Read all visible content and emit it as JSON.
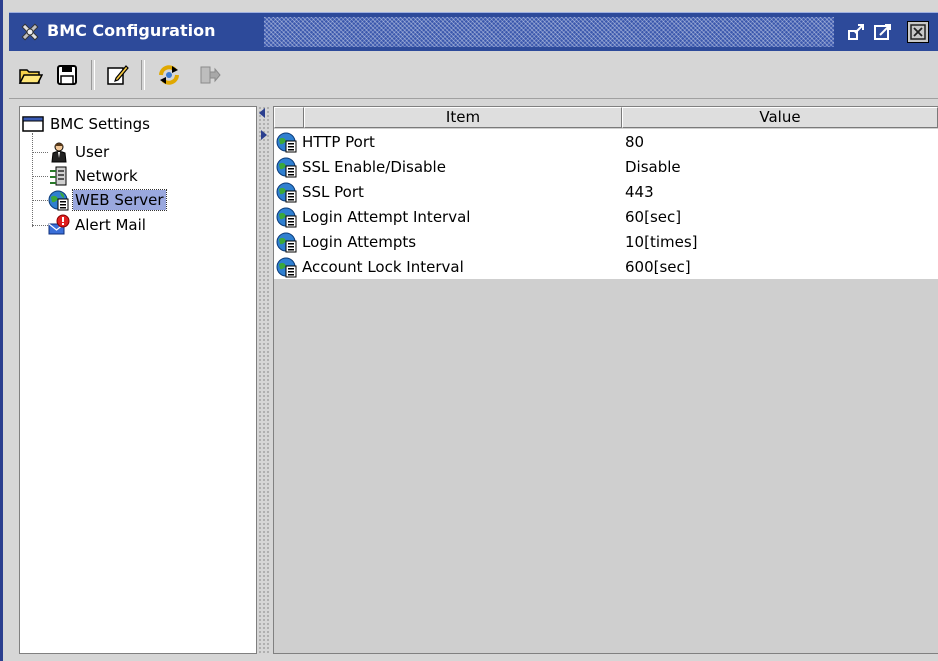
{
  "window": {
    "title": "BMC Configuration",
    "colors": {
      "title_bar": "#2d4a9a",
      "selection": "#9aa8de",
      "panel": "#d6d6d6"
    }
  },
  "toolbar": {
    "buttons": [
      {
        "icon": "folder-open-icon"
      },
      {
        "icon": "save-icon"
      },
      {
        "icon": "edit-icon"
      },
      {
        "icon": "refresh-icon"
      },
      {
        "icon": "exit-icon"
      }
    ]
  },
  "tree": {
    "root_label": "BMC Settings",
    "items": [
      {
        "label": "User",
        "icon": "user-icon",
        "selected": false
      },
      {
        "label": "Network",
        "icon": "network-icon",
        "selected": false
      },
      {
        "label": "WEB Server",
        "icon": "web-server-icon",
        "selected": true
      },
      {
        "label": "Alert Mail",
        "icon": "alert-mail-icon",
        "selected": false
      }
    ]
  },
  "table": {
    "columns": [
      "Item",
      "Value"
    ],
    "rows": [
      {
        "item": "HTTP Port",
        "value": "80"
      },
      {
        "item": "SSL Enable/Disable",
        "value": "Disable"
      },
      {
        "item": "SSL Port",
        "value": "443"
      },
      {
        "item": "Login Attempt Interval",
        "value": "60[sec]"
      },
      {
        "item": "Login Attempts",
        "value": "10[times]"
      },
      {
        "item": "Account Lock Interval",
        "value": "600[sec]"
      }
    ]
  }
}
